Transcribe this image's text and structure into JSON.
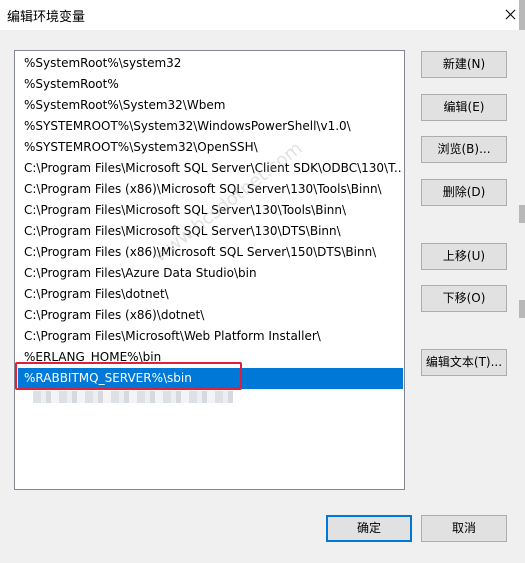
{
  "window": {
    "title": "编辑环境变量"
  },
  "paths": [
    "%SystemRoot%\\system32",
    "%SystemRoot%",
    "%SystemRoot%\\System32\\Wbem",
    "%SYSTEMROOT%\\System32\\WindowsPowerShell\\v1.0\\",
    "%SYSTEMROOT%\\System32\\OpenSSH\\",
    "C:\\Program Files\\Microsoft SQL Server\\Client SDK\\ODBC\\130\\T...",
    "C:\\Program Files (x86)\\Microsoft SQL Server\\130\\Tools\\Binn\\",
    "C:\\Program Files\\Microsoft SQL Server\\130\\Tools\\Binn\\",
    "C:\\Program Files\\Microsoft SQL Server\\130\\DTS\\Binn\\",
    "C:\\Program Files (x86)\\Microsoft SQL Server\\150\\DTS\\Binn\\",
    "C:\\Program Files\\Azure Data Studio\\bin",
    "C:\\Program Files\\dotnet\\",
    "C:\\Program Files (x86)\\dotnet\\",
    "C:\\Program Files\\Microsoft\\Web Platform Installer\\",
    "%ERLANG_HOME%\\bin",
    "%RABBITMQ_SERVER%\\sbin"
  ],
  "selected_index": 15,
  "buttons": {
    "new": "新建(N)",
    "edit": "编辑(E)",
    "browse": "浏览(B)...",
    "delete": "删除(D)",
    "move_up": "上移(U)",
    "move_down": "下移(O)",
    "edit_text": "编辑文本(T)...",
    "ok": "确定",
    "cancel": "取消"
  },
  "watermark": "www.bcsdotnet.com"
}
